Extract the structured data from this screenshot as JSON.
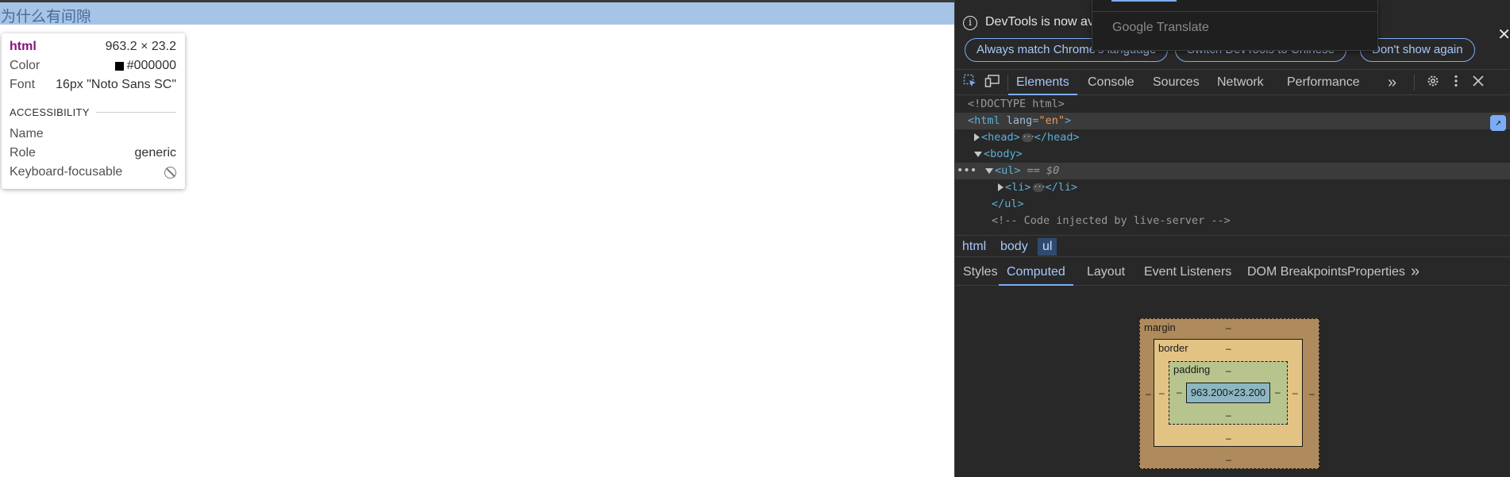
{
  "page": {
    "heading_text": "为什么有间隙"
  },
  "tooltip": {
    "tag": "html",
    "size": "963.2 × 23.2",
    "color_label": "Color",
    "color_value": "#000000",
    "font_label": "Font",
    "font_value": "16px \"Noto Sans SC\"",
    "section_title": "ACCESSIBILITY",
    "name_label": "Name",
    "role_label": "Role",
    "role_value": "generic",
    "keyboard_label": "Keyboard-focusable"
  },
  "infobar": {
    "message": "DevTools is now av",
    "buttons": [
      "Always match Chrome's language",
      "Switch DevTools to Chinese",
      "Don't show again"
    ],
    "close_glyph": "✕"
  },
  "translate_popup": {
    "label": "Google Translate"
  },
  "toolbar": {
    "tabs": [
      "Elements",
      "Console",
      "Sources",
      "Network",
      "Performance"
    ],
    "more_glyph": "»",
    "active_tab": "Elements"
  },
  "dom_tree": {
    "doctype": "<!DOCTYPE html>",
    "html_open": "<html",
    "html_attr": "lang",
    "html_attr_val": "\"en\"",
    "head_open": "<head>",
    "head_close": "</head>",
    "body_open": "<body>",
    "ul_open": "<ul>",
    "ul_marker": "== $0",
    "li_open": "<li>",
    "li_close": "</li>",
    "ul_close": "</ul>",
    "comment": "<!-- Code injected by live-server -->"
  },
  "breadcrumbs": [
    "html",
    "body",
    "ul"
  ],
  "subtabs": [
    "Styles",
    "Computed",
    "Layout",
    "Event Listeners",
    "DOM Breakpoints",
    "Properties"
  ],
  "subtabs_more": "»",
  "box_model": {
    "margin_label": "margin",
    "border_label": "border",
    "padding_label": "padding",
    "content_size": "963.200×23.200",
    "dash": "–"
  },
  "colors": {
    "accent": "#7cacf8",
    "devtools_bg": "#282828",
    "highlight": "#a6c4e6"
  }
}
